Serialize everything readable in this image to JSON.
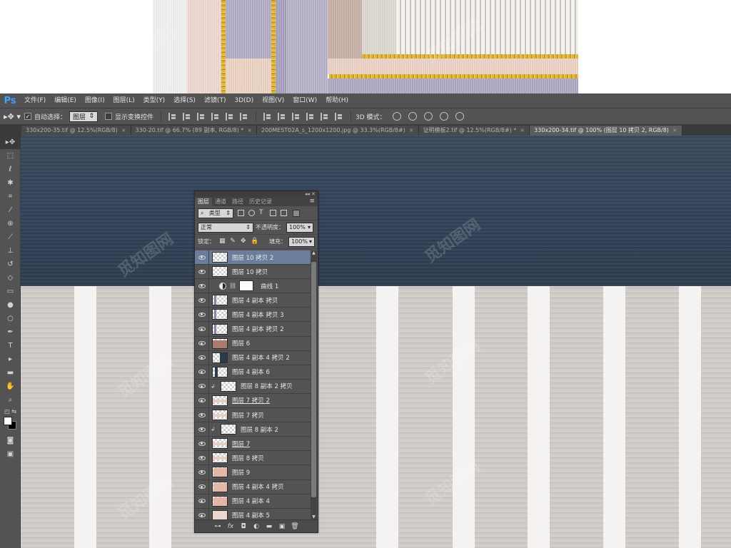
{
  "app": {
    "logo": "Ps"
  },
  "menu": [
    "文件(F)",
    "编辑(E)",
    "图像(I)",
    "图层(L)",
    "类型(Y)",
    "选择(S)",
    "滤镜(T)",
    "3D(D)",
    "视图(V)",
    "窗口(W)",
    "帮助(H)"
  ],
  "options": {
    "auto_select_label": "自动选择：",
    "auto_select_value": "图层",
    "show_transform_label": "显示变换控件",
    "mode_3d_label": "3D 模式："
  },
  "tabs": [
    {
      "label": "330x200-35.tif @ 12.5%(RGB/8)",
      "close": "×",
      "active": false
    },
    {
      "label": "330-20.tif @ 66.7% (89 副本, RGB/8) *",
      "close": "×",
      "active": false
    },
    {
      "label": "200MEST02A_s_1200x1200.jpg @ 33.3%(RGB/8#)",
      "close": "×",
      "active": false
    },
    {
      "label": "证明模板2.tif @ 12.5%(RGB/8#) *",
      "close": "×",
      "active": false
    },
    {
      "label": "330x200-34.tif @ 100% (图层 10 拷贝 2, RGB/8)",
      "close": "×",
      "active": true
    }
  ],
  "layers_panel": {
    "tabs": [
      "图层",
      "通道",
      "路径",
      "历史记录"
    ],
    "filter_label": "类型",
    "blend_mode": "正常",
    "opacity_label": "不透明度：",
    "opacity_value": "100%",
    "lock_label": "锁定：",
    "fill_label": "填充：",
    "fill_value": "100%",
    "layers": [
      {
        "name": "图层 10 拷贝 2",
        "selected": true,
        "kind": "normal",
        "thumb": "blank"
      },
      {
        "name": "图层 10 拷贝",
        "selected": false,
        "kind": "normal",
        "thumb": "blank"
      },
      {
        "name": "曲线 1",
        "selected": false,
        "kind": "adjustment",
        "thumb": "mask"
      },
      {
        "name": "图层 4 副本 拷贝",
        "selected": false,
        "kind": "normal",
        "thumb": "bar-lavender"
      },
      {
        "name": "图层 4 副本 拷贝 3",
        "selected": false,
        "kind": "normal",
        "thumb": "bar-lavender"
      },
      {
        "name": "图层 4 副本 拷贝 2",
        "selected": false,
        "kind": "normal",
        "thumb": "bar-lavender"
      },
      {
        "name": "图层 6",
        "selected": false,
        "kind": "normal",
        "thumb": "brown"
      },
      {
        "name": "图层 4 副本 4 拷贝 2",
        "selected": false,
        "kind": "normal",
        "thumb": "navy"
      },
      {
        "name": "图层 4 副本 6",
        "selected": false,
        "kind": "normal",
        "thumb": "navy-thin"
      },
      {
        "name": "图层 8 副本 2 拷贝",
        "selected": false,
        "kind": "clipped",
        "thumb": "blank"
      },
      {
        "name": "图层 7 拷贝 2",
        "selected": false,
        "kind": "normal",
        "thumb": "pink-strip",
        "underline": true
      },
      {
        "name": "图层 7 拷贝",
        "selected": false,
        "kind": "normal",
        "thumb": "pink-strip"
      },
      {
        "name": "图层 8 副本 2",
        "selected": false,
        "kind": "clipped",
        "thumb": "blank"
      },
      {
        "name": "图层 7",
        "selected": false,
        "kind": "normal",
        "thumb": "pink-strip",
        "underline": true
      },
      {
        "name": "图层 8 拷贝",
        "selected": false,
        "kind": "normal",
        "thumb": "pink-strip"
      },
      {
        "name": "图层 9",
        "selected": false,
        "kind": "normal",
        "thumb": "peach"
      },
      {
        "name": "图层 4 副本 4 拷贝",
        "selected": false,
        "kind": "normal",
        "thumb": "peach"
      },
      {
        "name": "图层 4 副本 4",
        "selected": false,
        "kind": "normal",
        "thumb": "peach"
      },
      {
        "name": "图层 4 副本 5",
        "selected": false,
        "kind": "normal",
        "thumb": "pink-full"
      }
    ],
    "footer_icons": [
      "link-layers-icon",
      "fx-icon",
      "add-mask-icon",
      "adjustment-icon",
      "group-icon",
      "new-layer-icon",
      "trash-icon"
    ]
  },
  "watermark_text": "觅知图网",
  "colors": {
    "ps_blue": "#3fa0ff",
    "selected_layer": "#6a7e9c",
    "panel_bg": "#535353"
  }
}
